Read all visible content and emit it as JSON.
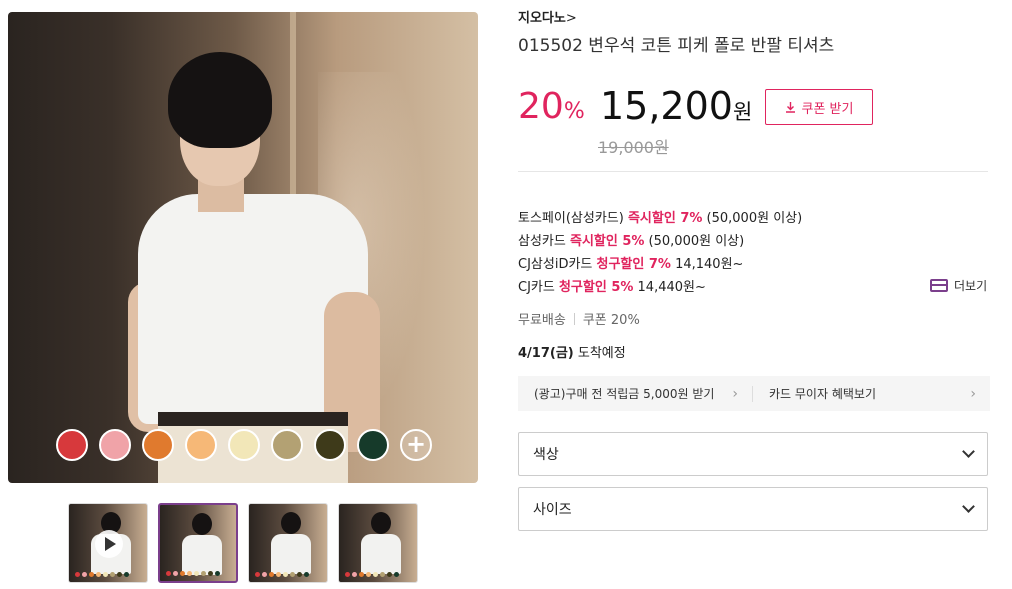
{
  "gallery": {
    "swatches": [
      {
        "name": "red",
        "color": "#d7393c"
      },
      {
        "name": "pink",
        "color": "#f0a3a8"
      },
      {
        "name": "orange",
        "color": "#e07a2e"
      },
      {
        "name": "peach",
        "color": "#f6b877"
      },
      {
        "name": "cream",
        "color": "#f2e7b8"
      },
      {
        "name": "beige",
        "color": "#b3a173"
      },
      {
        "name": "olive",
        "color": "#3e3a1a"
      },
      {
        "name": "dark-green",
        "color": "#163a2a"
      }
    ],
    "thumbnails": [
      {
        "type": "video",
        "active": false
      },
      {
        "type": "image",
        "active": true
      },
      {
        "type": "image",
        "active": false
      },
      {
        "type": "image",
        "active": false
      }
    ]
  },
  "product": {
    "brand": "지오다노",
    "brand_chevron": ">",
    "title": "015502 변우석 코튼 피케 폴로 반팔 티셔츠",
    "discount": "20",
    "discount_unit": "%",
    "price": "15,200",
    "price_unit": "원",
    "original_price": "19,000원",
    "coupon_label": "쿠폰 받기"
  },
  "benefits": {
    "items": [
      {
        "prefix": "토스페이(삼성카드) ",
        "highlight": "즉시할인 7%",
        "suffix": " (50,000원 이상)"
      },
      {
        "prefix": "삼성카드 ",
        "highlight": "즉시할인 5%",
        "suffix": " (50,000원 이상)"
      },
      {
        "prefix": "CJ삼성iD카드 ",
        "highlight": "청구할인 7%",
        "suffix": " 14,140원~"
      },
      {
        "prefix": "CJ카드 ",
        "highlight": "청구할인 5%",
        "suffix": " 14,440원~"
      }
    ],
    "more_label": "더보기"
  },
  "shipping": {
    "free_shipping": "무료배송",
    "coupon": "쿠폰 20%",
    "arrival_date": "4/17(금)",
    "arrival_label": " 도착예정"
  },
  "promo": {
    "left": "(광고)구매 전 적립금 5,000원 받기",
    "right": "카드 무이자 혜택보기",
    "chevron": "›"
  },
  "options": {
    "color_label": "색상",
    "size_label": "사이즈"
  },
  "colors": {
    "accent": "#e0245e",
    "purple": "#7b3f8c"
  }
}
